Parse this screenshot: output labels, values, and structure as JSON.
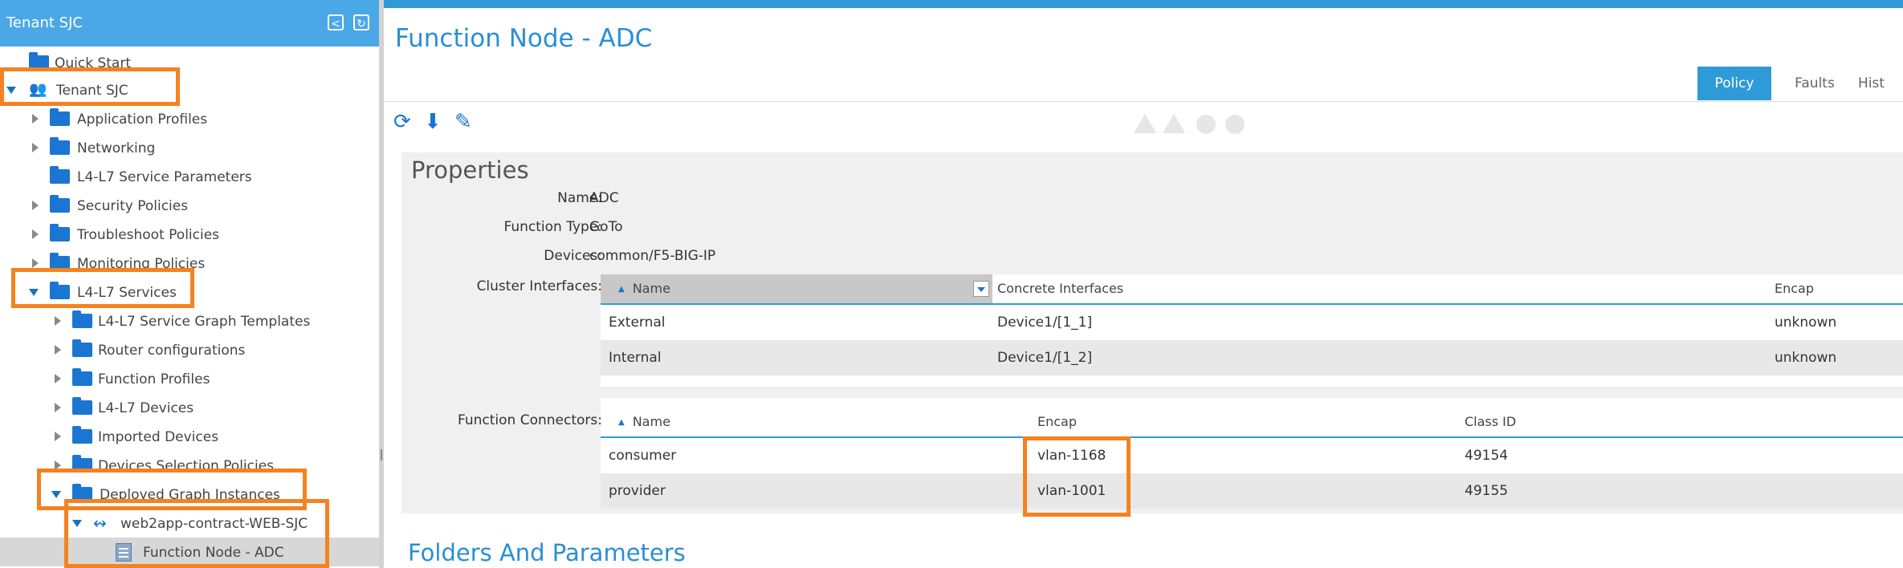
{
  "sidebar": {
    "title": "Tenant SJC",
    "header_icons": [
      "collapse-icon",
      "refresh-icon"
    ],
    "tree": [
      {
        "label": "Quick Start",
        "icon": "folder-icon"
      },
      {
        "label": "Tenant SJC",
        "icon": "tenant-icon"
      },
      {
        "label": "Application Profiles",
        "icon": "folder-icon"
      },
      {
        "label": "Networking",
        "icon": "folder-icon"
      },
      {
        "label": "L4-L7 Service Parameters",
        "icon": "folder-icon"
      },
      {
        "label": "Security Policies",
        "icon": "folder-icon"
      },
      {
        "label": "Troubleshoot Policies",
        "icon": "folder-icon"
      },
      {
        "label": "Monitoring Policies",
        "icon": "folder-icon"
      },
      {
        "label": "L4-L7 Services",
        "icon": "folder-icon"
      },
      {
        "label": "L4-L7 Service Graph Templates",
        "icon": "folder-icon"
      },
      {
        "label": "Router configurations",
        "icon": "folder-icon"
      },
      {
        "label": "Function Profiles",
        "icon": "folder-icon"
      },
      {
        "label": "L4-L7 Devices",
        "icon": "folder-icon"
      },
      {
        "label": "Imported Devices",
        "icon": "folder-icon"
      },
      {
        "label": "Devices Selection Policies",
        "icon": "folder-icon"
      },
      {
        "label": "Deployed Graph Instances",
        "icon": "folder-icon"
      },
      {
        "label": "web2app-contract-WEB-SJC",
        "icon": "graph-instance-icon"
      },
      {
        "label": "Function Node - ADC",
        "icon": "document-icon",
        "selected": true
      }
    ]
  },
  "main": {
    "title": "Function Node - ADC",
    "tabs": [
      "Policy",
      "Faults",
      "Hist"
    ],
    "active_tab": "Policy",
    "toolbar_icons": [
      "refresh-icon",
      "download-icon",
      "edit-icon"
    ],
    "fault_icons": [
      "critical-warning-icon",
      "major-warning-icon",
      "minor-fault-icon",
      "info-fault-icon"
    ],
    "properties": {
      "title": "Properties",
      "name_label": "Name:",
      "name_value": "ADC",
      "function_type_label": "Function Type:",
      "function_type_value": "GoTo",
      "devices_label": "Devices:",
      "devices_value": "common/F5-BIG-IP",
      "cluster_interfaces_label": "Cluster Interfaces:",
      "function_connectors_label": "Function Connectors:"
    },
    "cluster_interfaces": {
      "columns": [
        "Name",
        "Concrete Interfaces",
        "Encap"
      ],
      "rows": [
        {
          "name": "External",
          "concrete": "Device1/[1_1]",
          "encap": "unknown"
        },
        {
          "name": "Internal",
          "concrete": "Device1/[1_2]",
          "encap": "unknown"
        }
      ]
    },
    "function_connectors": {
      "columns": [
        "Name",
        "Encap",
        "Class ID"
      ],
      "rows": [
        {
          "name": "consumer",
          "encap": "vlan-1168",
          "class_id": "49154"
        },
        {
          "name": "provider",
          "encap": "vlan-1001",
          "class_id": "49155"
        }
      ]
    },
    "folders_title": "Folders And Parameters"
  },
  "colors": {
    "accent": "#2e9ad8",
    "highlight_box": "#f58220",
    "folder": "#1a76d2"
  }
}
